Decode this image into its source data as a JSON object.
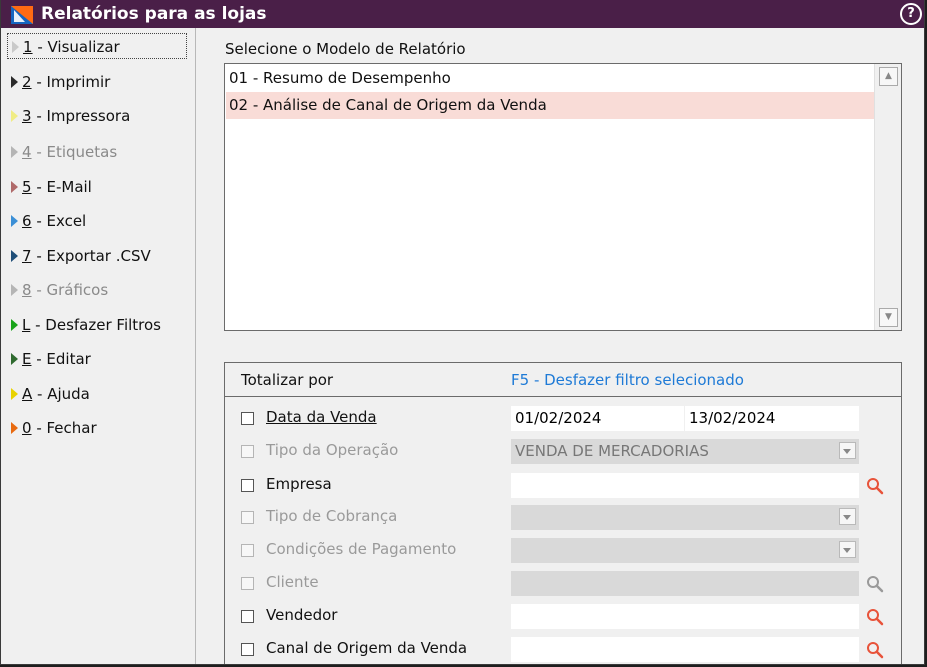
{
  "window": {
    "title": "Relatórios para as lojas",
    "help": "?"
  },
  "sidebar": {
    "items": [
      {
        "key": "1",
        "label": " - Visualizar",
        "state": "active",
        "arrow": "#c9c9c9"
      },
      {
        "key": "2",
        "label": " - Imprimir",
        "state": "normal",
        "arrow": "#2b2b2b"
      },
      {
        "key": "3",
        "label": " - Impressora",
        "state": "normal",
        "arrow": "#f0ec84"
      },
      {
        "key": "4",
        "label": " - Etiquetas",
        "state": "disabled",
        "arrow": "#b5b5b5"
      },
      {
        "key": "5",
        "label": " - E-Mail",
        "state": "normal",
        "arrow": "#b06a6a"
      },
      {
        "key": "6",
        "label": " - Excel",
        "state": "normal",
        "arrow": "#3b8fd6"
      },
      {
        "key": "7",
        "label": " - Exportar .CSV",
        "state": "normal",
        "arrow": "#1f4e78"
      },
      {
        "key": "8",
        "label": " - Gráficos",
        "state": "disabled",
        "arrow": "#b5b5b5"
      },
      {
        "key": "L",
        "label": " - Desfazer Filtros",
        "state": "normal",
        "arrow": "#19a31a"
      },
      {
        "key": "E",
        "label": " - Editar",
        "state": "normal",
        "arrow": "#2f6a2f"
      },
      {
        "key": "A",
        "label": " - Ajuda",
        "state": "normal",
        "arrow": "#e8d200"
      },
      {
        "key": "0",
        "label": " - Fechar",
        "state": "normal",
        "arrow": "#e86a10"
      }
    ]
  },
  "models": {
    "label": "Selecione o Modelo de Relatório",
    "items": [
      {
        "label": "01 - Resumo de Desempenho",
        "selected": false
      },
      {
        "label": "02 - Análise de Canal de Origem da Venda",
        "selected": true
      }
    ]
  },
  "filters": {
    "header_total": "Totalizar por",
    "header_undo": "F5 - Desfazer filtro selecionado",
    "rows": [
      {
        "label": "Data da Venda",
        "enabled": true,
        "checked": false,
        "type": "daterange",
        "date_from": "01/02/2024",
        "date_to": "13/02/2024"
      },
      {
        "label": "Tipo da Operação",
        "enabled": false,
        "checked": false,
        "type": "dropdown",
        "value": "VENDA DE MERCADORIAS"
      },
      {
        "label": "Empresa",
        "enabled": true,
        "checked": false,
        "type": "lookup",
        "value": ""
      },
      {
        "label": "Tipo de Cobrança",
        "enabled": false,
        "checked": false,
        "type": "dropdown",
        "value": ""
      },
      {
        "label": "Condições de Pagamento",
        "enabled": false,
        "checked": false,
        "type": "dropdown",
        "value": ""
      },
      {
        "label": "Cliente",
        "enabled": false,
        "checked": false,
        "type": "lookup",
        "value": ""
      },
      {
        "label": "Vendedor",
        "enabled": true,
        "checked": false,
        "type": "lookup",
        "value": ""
      },
      {
        "label": "Canal de Origem da Venda",
        "enabled": true,
        "checked": false,
        "type": "lookup",
        "value": ""
      }
    ]
  },
  "colors": {
    "titlebar": "#4a1f48",
    "selected_row": "#f9dcd7",
    "link_blue": "#1e7ad6",
    "search_active": "#e8533a",
    "search_disabled": "#9a9a9a"
  },
  "icons": {
    "logo": "app-logo-icon",
    "help": "help-icon",
    "search": "search-icon",
    "dropdown": "chevron-down-icon"
  }
}
